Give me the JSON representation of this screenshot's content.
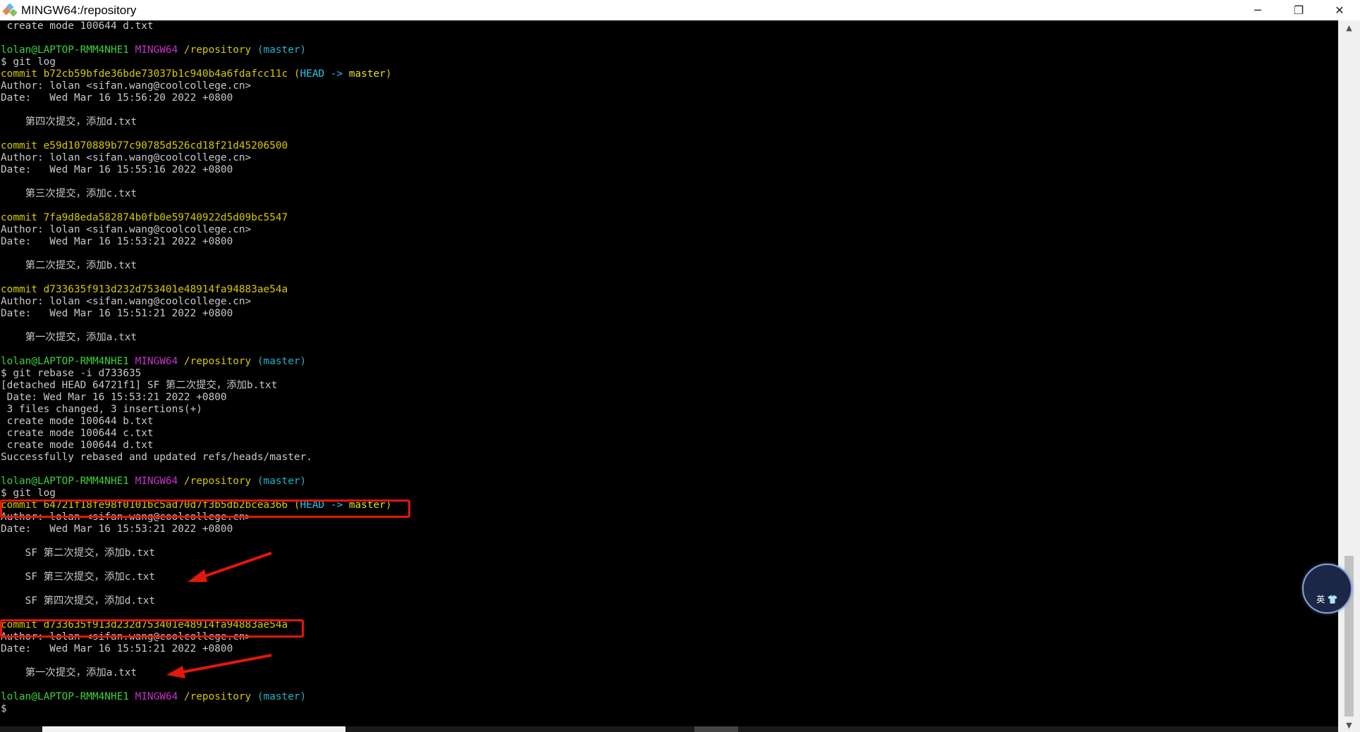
{
  "window": {
    "title": "MINGW64:/repository",
    "controls": {
      "minimize": "─",
      "restore": "❐",
      "close": "✕"
    }
  },
  "terminal": {
    "lines": [
      [
        {
          "t": " create mode 100644 d.txt",
          "c": "w"
        }
      ],
      [
        {
          "t": "",
          "c": "w"
        }
      ],
      [
        {
          "t": "lolan@LAPTOP-RMM4NHE1 ",
          "c": "u"
        },
        {
          "t": "MINGW64 ",
          "c": "m"
        },
        {
          "t": "/repository ",
          "c": "y"
        },
        {
          "t": "(master)",
          "c": "c"
        }
      ],
      [
        {
          "t": "$ git log",
          "c": "w"
        }
      ],
      [
        {
          "t": "commit b72cb59bfde36bde73037b1c940b4a6fdafcc11c ",
          "c": "hy"
        },
        {
          "t": "(",
          "c": "hy"
        },
        {
          "t": "HEAD -> ",
          "c": "hc"
        },
        {
          "t": "master",
          "c": "hl"
        },
        {
          "t": ")",
          "c": "hy"
        }
      ],
      [
        {
          "t": "Author: lolan <sifan.wang@coolcollege.cn>",
          "c": "w"
        }
      ],
      [
        {
          "t": "Date:   Wed Mar 16 15:56:20 2022 +0800",
          "c": "w"
        }
      ],
      [
        {
          "t": "",
          "c": "w"
        }
      ],
      [
        {
          "t": "    第四次提交，添加d.txt",
          "c": "w"
        }
      ],
      [
        {
          "t": "",
          "c": "w"
        }
      ],
      [
        {
          "t": "commit e59d1070889b77c90785d526cd18f21d45206500",
          "c": "hy"
        }
      ],
      [
        {
          "t": "Author: lolan <sifan.wang@coolcollege.cn>",
          "c": "w"
        }
      ],
      [
        {
          "t": "Date:   Wed Mar 16 15:55:16 2022 +0800",
          "c": "w"
        }
      ],
      [
        {
          "t": "",
          "c": "w"
        }
      ],
      [
        {
          "t": "    第三次提交，添加c.txt",
          "c": "w"
        }
      ],
      [
        {
          "t": "",
          "c": "w"
        }
      ],
      [
        {
          "t": "commit 7fa9d8eda582874b0fb0e59740922d5d09bc5547",
          "c": "hy"
        }
      ],
      [
        {
          "t": "Author: lolan <sifan.wang@coolcollege.cn>",
          "c": "w"
        }
      ],
      [
        {
          "t": "Date:   Wed Mar 16 15:53:21 2022 +0800",
          "c": "w"
        }
      ],
      [
        {
          "t": "",
          "c": "w"
        }
      ],
      [
        {
          "t": "    第二次提交，添加b.txt",
          "c": "w"
        }
      ],
      [
        {
          "t": "",
          "c": "w"
        }
      ],
      [
        {
          "t": "commit d733635f913d232d753401e48914fa94883ae54a",
          "c": "hy"
        }
      ],
      [
        {
          "t": "Author: lolan <sifan.wang@coolcollege.cn>",
          "c": "w"
        }
      ],
      [
        {
          "t": "Date:   Wed Mar 16 15:51:21 2022 +0800",
          "c": "w"
        }
      ],
      [
        {
          "t": "",
          "c": "w"
        }
      ],
      [
        {
          "t": "    第一次提交，添加a.txt",
          "c": "w"
        }
      ],
      [
        {
          "t": "",
          "c": "w"
        }
      ],
      [
        {
          "t": "lolan@LAPTOP-RMM4NHE1 ",
          "c": "u"
        },
        {
          "t": "MINGW64 ",
          "c": "m"
        },
        {
          "t": "/repository ",
          "c": "y"
        },
        {
          "t": "(master)",
          "c": "c"
        }
      ],
      [
        {
          "t": "$ git rebase -i d733635",
          "c": "w"
        }
      ],
      [
        {
          "t": "[detached HEAD 64721f1] SF 第二次提交，添加b.txt",
          "c": "w"
        }
      ],
      [
        {
          "t": " Date: Wed Mar 16 15:53:21 2022 +0800",
          "c": "w"
        }
      ],
      [
        {
          "t": " 3 files changed, 3 insertions(+)",
          "c": "w"
        }
      ],
      [
        {
          "t": " create mode 100644 b.txt",
          "c": "w"
        }
      ],
      [
        {
          "t": " create mode 100644 c.txt",
          "c": "w"
        }
      ],
      [
        {
          "t": " create mode 100644 d.txt",
          "c": "w"
        }
      ],
      [
        {
          "t": "Successfully rebased and updated refs/heads/master.",
          "c": "w"
        }
      ],
      [
        {
          "t": "",
          "c": "w"
        }
      ],
      [
        {
          "t": "lolan@LAPTOP-RMM4NHE1 ",
          "c": "u"
        },
        {
          "t": "MINGW64 ",
          "c": "m"
        },
        {
          "t": "/repository ",
          "c": "y"
        },
        {
          "t": "(master)",
          "c": "c"
        }
      ],
      [
        {
          "t": "$ git log",
          "c": "w"
        }
      ],
      [
        {
          "t": "commit 64721f18fe98f0101bc5ad70d7f3b5db2bcea366 ",
          "c": "hy"
        },
        {
          "t": "(",
          "c": "hy"
        },
        {
          "t": "HEAD -> ",
          "c": "hc"
        },
        {
          "t": "master",
          "c": "hl"
        },
        {
          "t": ")",
          "c": "hy"
        }
      ],
      [
        {
          "t": "Author: lolan <sifan.wang@coolcollege.cn>",
          "c": "w"
        }
      ],
      [
        {
          "t": "Date:   Wed Mar 16 15:53:21 2022 +0800",
          "c": "w"
        }
      ],
      [
        {
          "t": "",
          "c": "w"
        }
      ],
      [
        {
          "t": "    SF 第二次提交，添加b.txt",
          "c": "w"
        }
      ],
      [
        {
          "t": "",
          "c": "w"
        }
      ],
      [
        {
          "t": "    SF 第三次提交，添加c.txt",
          "c": "w"
        }
      ],
      [
        {
          "t": "",
          "c": "w"
        }
      ],
      [
        {
          "t": "    SF 第四次提交，添加d.txt",
          "c": "w"
        }
      ],
      [
        {
          "t": "",
          "c": "w"
        }
      ],
      [
        {
          "t": "commit d733635f913d232d753401e48914fa94883ae54a",
          "c": "hy"
        }
      ],
      [
        {
          "t": "Author: lolan <sifan.wang@coolcollege.cn>",
          "c": "w"
        }
      ],
      [
        {
          "t": "Date:   Wed Mar 16 15:51:21 2022 +0800",
          "c": "w"
        }
      ],
      [
        {
          "t": "",
          "c": "w"
        }
      ],
      [
        {
          "t": "    第一次提交，添加a.txt",
          "c": "w"
        }
      ],
      [
        {
          "t": "",
          "c": "w"
        }
      ],
      [
        {
          "t": "lolan@LAPTOP-RMM4NHE1 ",
          "c": "u"
        },
        {
          "t": "MINGW64 ",
          "c": "m"
        },
        {
          "t": "/repository ",
          "c": "y"
        },
        {
          "t": "(master)",
          "c": "c"
        }
      ],
      [
        {
          "t": "$",
          "c": "w"
        }
      ]
    ]
  },
  "scrollbar": {
    "up_arrow": "▲",
    "down_arrow": "▼"
  },
  "widget": {
    "label": "英 👕"
  },
  "colors": {
    "background": "#000000",
    "annotation_red": "#e3170a"
  }
}
